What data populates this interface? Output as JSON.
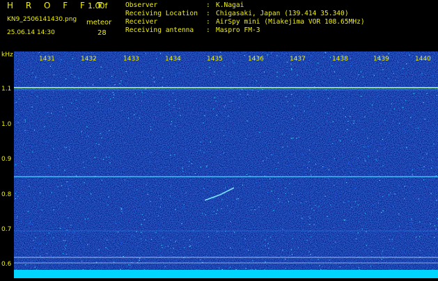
{
  "header": {
    "brand": "H R O F F T",
    "version": "1.00f",
    "filename": "KN9_2506141430.png",
    "meteor_label": "meteor",
    "datetime": "25.06.14 14:30",
    "meteor_count": "28"
  },
  "info": [
    {
      "key": "Observer",
      "value": "K.Nagai"
    },
    {
      "key": "Receiving Location",
      "value": "Chigasaki, Japan (139.414 35.340)"
    },
    {
      "key": "Receiver",
      "value": "AirSpy mini (Miakejima VOR 108.65MHz)"
    },
    {
      "key": "Receiving antenna",
      "value": "Maspro FM-3"
    }
  ],
  "axis": {
    "y_unit": "kHz",
    "y_ticks": [
      "1.1",
      "1.0",
      "0.9",
      "0.8",
      "0.7",
      "0.6"
    ],
    "x_ticks": [
      "1431",
      "1432",
      "1433",
      "1434",
      "1435",
      "1436",
      "1437",
      "1438",
      "1439",
      "1440"
    ]
  },
  "colors": {
    "text": "#f2f200",
    "background": "#000000",
    "spectrogram": "#051a8c"
  }
}
